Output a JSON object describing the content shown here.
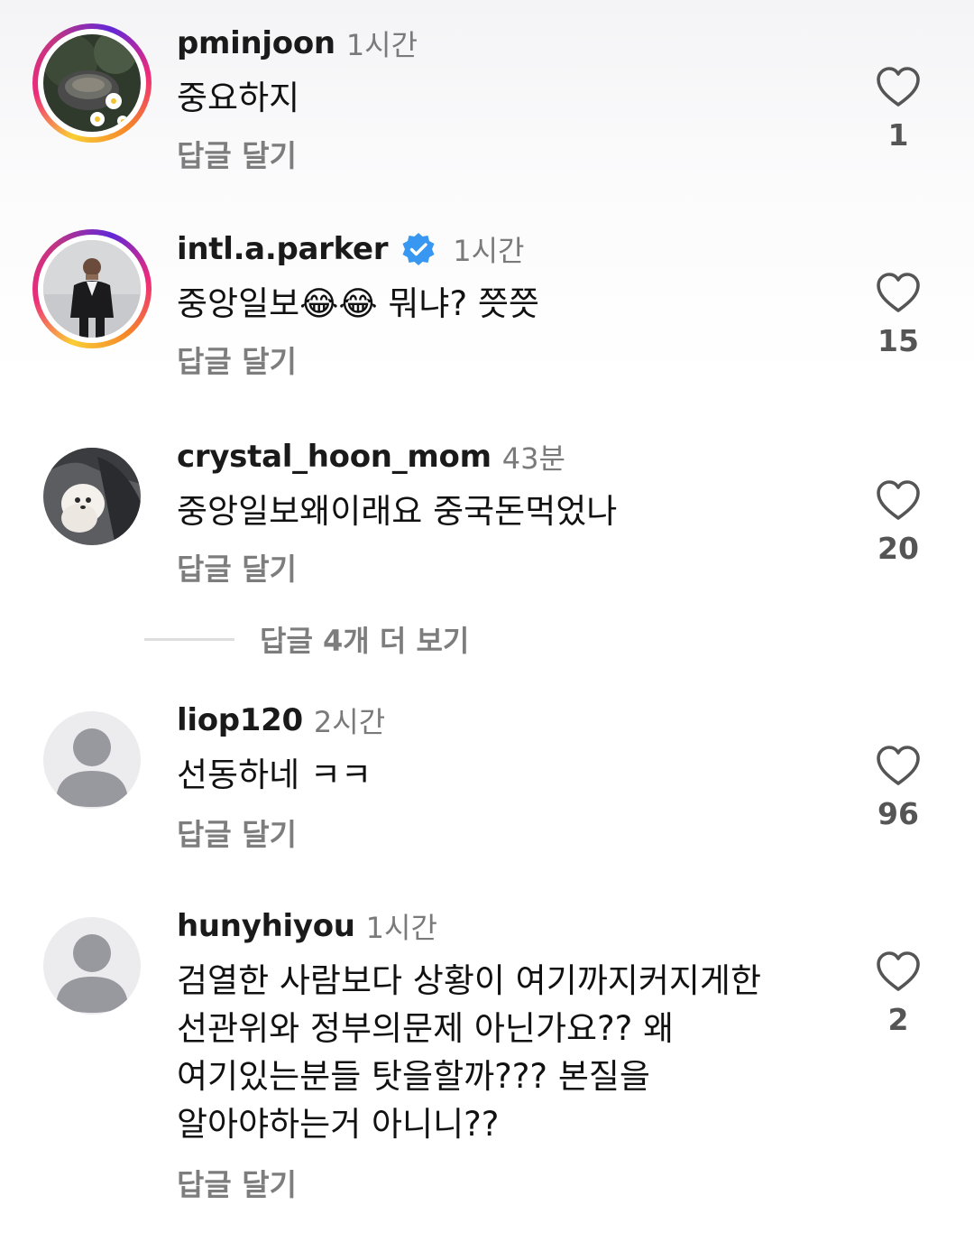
{
  "reply_label": "답글 달기",
  "view_more_replies": "답글 4개 더 보기",
  "colors": {
    "username": "#1a1a1a",
    "secondary": "#7d7d7d",
    "verified": "#3897f0",
    "default_avatar_bg": "#ececef",
    "default_avatar_fg": "#98989f"
  },
  "comments": [
    {
      "username": "pminjoon",
      "time": "1시간",
      "text": "중요하지",
      "likes": "1",
      "avatar": "photo-flowers",
      "story_ring": true,
      "verified": false
    },
    {
      "username": "intl.a.parker",
      "time": "1시간",
      "text": "중앙일보😂😂 뭐냐? 쯧쯧",
      "likes": "15",
      "avatar": "photo-man-suit",
      "story_ring": true,
      "verified": true
    },
    {
      "username": "crystal_hoon_mom",
      "time": "43분",
      "text": "중앙일보왜이래요 중국돈먹었나",
      "likes": "20",
      "avatar": "photo-white-dog",
      "story_ring": false,
      "verified": false
    },
    {
      "username": "liop120",
      "time": "2시간",
      "text": "선동하네 ㅋㅋ",
      "likes": "96",
      "avatar": "default-user-icon",
      "story_ring": false,
      "verified": false
    },
    {
      "username": "hunyhiyou",
      "time": "1시간",
      "text": "검열한 사람보다 상황이 여기까지커지게한\n선관위와 정부의문제 아닌가요?? 왜\n여기있는분들 탓을할까??? 본질을\n알아야하는거 아니니??",
      "likes": "2",
      "avatar": "default-user-icon",
      "story_ring": false,
      "verified": false
    }
  ]
}
